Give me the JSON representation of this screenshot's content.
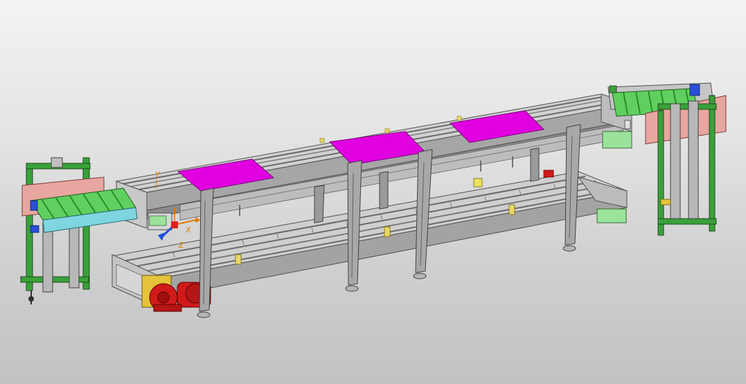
{
  "viewport": {
    "background_top": "#f3f3f3",
    "background_bottom": "#c2c2c2"
  },
  "model": {
    "description_visible": false,
    "colors": {
      "frame_gray": "#9b9b9b",
      "frame_light": "#cfcfcf",
      "frame_dark": "#505050",
      "pallet_magenta": "#e000e0",
      "pallet_edge": "#7a007a",
      "roller_green": "#48e048",
      "frame_green": "#3aa13a",
      "panel_pink": "#e8a6a0",
      "motor_red": "#d11a1a",
      "motor_flange_yellow": "#e6c23a",
      "guide_cyan": "#7fd6e0",
      "accent_blue": "#2a4fd8",
      "sensor_yellow": "#f0e060",
      "light_green_box": "#9be39b"
    },
    "pallet_count": 3
  },
  "triad": {
    "x_label": "X",
    "y_label": "Y",
    "z_label": "Z",
    "x_color": "#e07b00",
    "y_color": "#e07b00",
    "z_color": "#1f4fd8"
  }
}
